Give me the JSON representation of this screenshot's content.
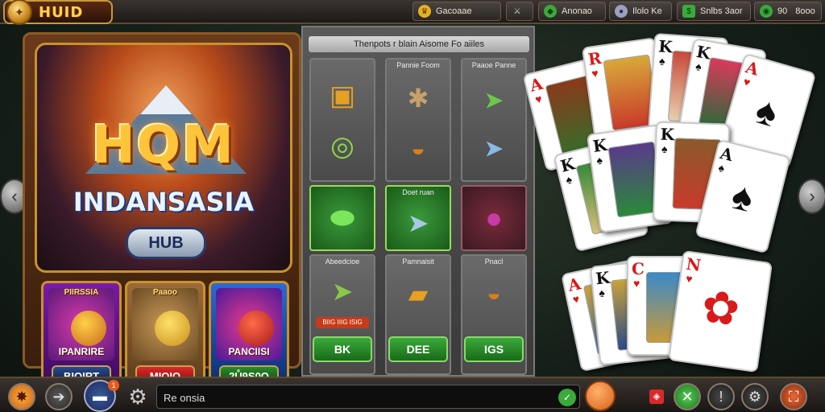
{
  "topbar": {
    "logo_text": "HUID",
    "stats": [
      {
        "label": "Gacoaae",
        "icon": "gold-crest-icon",
        "color": "#e8b020"
      },
      {
        "label": "",
        "icon": "crossed-swords-icon",
        "color": "#cfcfcf"
      },
      {
        "label": "Anonao",
        "icon": "green-gem-icon",
        "color": "#3aaa3a"
      },
      {
        "label": "Ilolo Ke",
        "icon": "silver-orb-icon",
        "color": "#9aa0c0"
      },
      {
        "label": "Snlbs 3aor",
        "icon": "cash-icon",
        "color": "#3aaa3a"
      },
      {
        "label": "90",
        "icon": "green-chip-icon",
        "color": "#3aaa3a"
      },
      {
        "label": "8ooo",
        "icon": "",
        "color": ""
      }
    ]
  },
  "hero": {
    "title": "HQM",
    "subtitle": "INDANSASIA",
    "badge": "HUB"
  },
  "games": [
    {
      "title": "PIIRSSIA",
      "title2": "IPANRIRE",
      "button": "BIOIRT"
    },
    {
      "title": "Paaoo",
      "title2": "",
      "button": "MIOIO"
    },
    {
      "title": "",
      "title2": "PANCIISI",
      "button": "2Ů9S0O"
    }
  ],
  "middle": {
    "header": "Thenpots r blain Aisome Fo aiiles",
    "tiles": [
      {
        "label": ""
      },
      {
        "label": "Pannie Foom"
      },
      {
        "label": "Paaoe Panne"
      },
      {
        "label": ""
      },
      {
        "label": ""
      },
      {
        "label": ""
      },
      {
        "label": ""
      },
      {
        "label": "Doet ruan"
      },
      {
        "label": ""
      },
      {
        "label": "Abeedcioe"
      },
      {
        "label": "Pamnaisit"
      },
      {
        "label": "Pnacl"
      }
    ],
    "tag": "BIIG IIIG ISIG",
    "buttons": [
      "BK",
      "DEE",
      "IGS"
    ]
  },
  "cards": [
    {
      "rank": "A",
      "suit": "♥",
      "color": "red"
    },
    {
      "rank": "R",
      "suit": "♥",
      "color": "red"
    },
    {
      "rank": "K",
      "suit": "♠",
      "color": "blk"
    },
    {
      "rank": "K",
      "suit": "♠",
      "color": "blk"
    },
    {
      "rank": "A",
      "suit": "♥",
      "color": "red"
    },
    {
      "rank": "K",
      "suit": "♠",
      "color": "blk"
    },
    {
      "rank": "K",
      "suit": "♠",
      "color": "blk"
    },
    {
      "rank": "K",
      "suit": "♠",
      "color": "blk"
    },
    {
      "rank": "A",
      "suit": "♠",
      "color": "blk"
    },
    {
      "rank": "A",
      "suit": "♥",
      "color": "red"
    },
    {
      "rank": "K",
      "suit": "♠",
      "color": "blk"
    },
    {
      "rank": "C",
      "suit": "♥",
      "color": "red"
    },
    {
      "rank": "N",
      "suit": "♥",
      "color": "red"
    }
  ],
  "bottombar": {
    "chat_value": "Re onsia",
    "badge": "1"
  }
}
